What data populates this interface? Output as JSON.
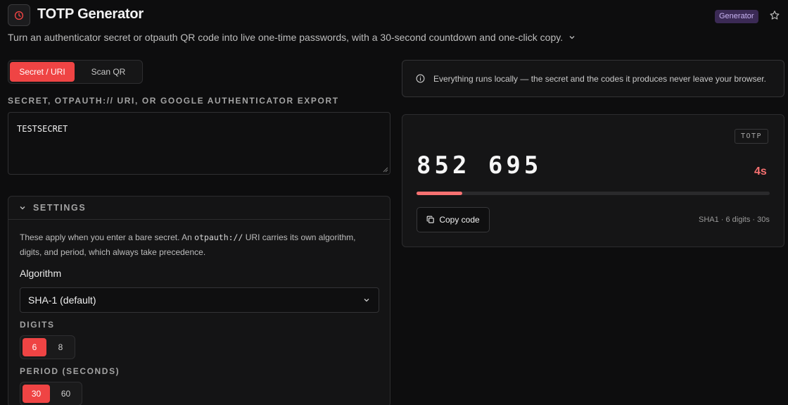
{
  "header": {
    "title": "TOTP Generator",
    "badge": "Generator",
    "icon": "clock-icon",
    "subtitle": "Turn an authenticator secret or otpauth QR code into live one-time passwords, with a 30-second countdown and one-click copy."
  },
  "mode_tabs": [
    {
      "label": "Secret / URI",
      "active": true
    },
    {
      "label": "Scan QR",
      "active": false
    }
  ],
  "secret_section": {
    "label": "SECRET, OTPAUTH:// URI, OR GOOGLE AUTHENTICATOR EXPORT",
    "value": "TESTSECRET"
  },
  "settings": {
    "title": "SETTINGS",
    "desc_pre": "These apply when you enter a bare secret. An",
    "desc_code": "otpauth://",
    "desc_post": "URI carries its own algorithm, digits, and period, which always take precedence.",
    "algorithm_label": "Algorithm",
    "algorithm_value": "SHA-1 (default)",
    "digits_label": "DIGITS",
    "digits_options": [
      "6",
      "8"
    ],
    "digits_selected": "6",
    "period_label": "PERIOD (SECONDS)",
    "period_options": [
      "30",
      "60"
    ],
    "period_selected": "30"
  },
  "info_banner": {
    "text": "Everything runs locally — the secret and the codes it produces never leave your browser."
  },
  "otp": {
    "type_badge": "TOTP",
    "code": "852 695",
    "countdown": "4s",
    "progress_fraction": 0.13,
    "copy_label": "Copy code",
    "meta": "SHA1 · 6 digits · 30s"
  },
  "colors": {
    "accent": "#ef4444",
    "countdown": "#f87171",
    "badge_bg": "#3b2a55"
  }
}
